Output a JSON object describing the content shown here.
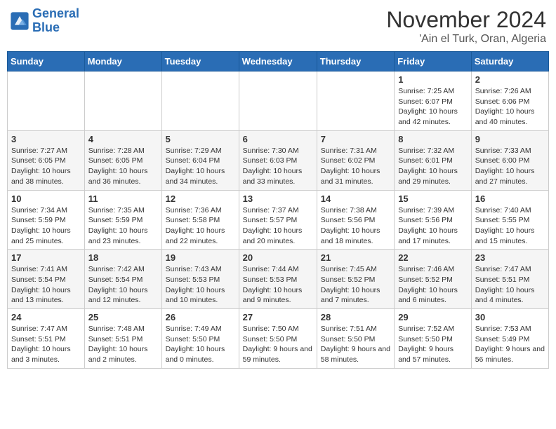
{
  "header": {
    "logo_line1": "General",
    "logo_line2": "Blue",
    "title": "November 2024",
    "subtitle": "'Ain el Turk, Oran, Algeria"
  },
  "weekdays": [
    "Sunday",
    "Monday",
    "Tuesday",
    "Wednesday",
    "Thursday",
    "Friday",
    "Saturday"
  ],
  "weeks": [
    [
      {
        "day": "",
        "info": ""
      },
      {
        "day": "",
        "info": ""
      },
      {
        "day": "",
        "info": ""
      },
      {
        "day": "",
        "info": ""
      },
      {
        "day": "",
        "info": ""
      },
      {
        "day": "1",
        "info": "Sunrise: 7:25 AM\nSunset: 6:07 PM\nDaylight: 10 hours and 42 minutes."
      },
      {
        "day": "2",
        "info": "Sunrise: 7:26 AM\nSunset: 6:06 PM\nDaylight: 10 hours and 40 minutes."
      }
    ],
    [
      {
        "day": "3",
        "info": "Sunrise: 7:27 AM\nSunset: 6:05 PM\nDaylight: 10 hours and 38 minutes."
      },
      {
        "day": "4",
        "info": "Sunrise: 7:28 AM\nSunset: 6:05 PM\nDaylight: 10 hours and 36 minutes."
      },
      {
        "day": "5",
        "info": "Sunrise: 7:29 AM\nSunset: 6:04 PM\nDaylight: 10 hours and 34 minutes."
      },
      {
        "day": "6",
        "info": "Sunrise: 7:30 AM\nSunset: 6:03 PM\nDaylight: 10 hours and 33 minutes."
      },
      {
        "day": "7",
        "info": "Sunrise: 7:31 AM\nSunset: 6:02 PM\nDaylight: 10 hours and 31 minutes."
      },
      {
        "day": "8",
        "info": "Sunrise: 7:32 AM\nSunset: 6:01 PM\nDaylight: 10 hours and 29 minutes."
      },
      {
        "day": "9",
        "info": "Sunrise: 7:33 AM\nSunset: 6:00 PM\nDaylight: 10 hours and 27 minutes."
      }
    ],
    [
      {
        "day": "10",
        "info": "Sunrise: 7:34 AM\nSunset: 5:59 PM\nDaylight: 10 hours and 25 minutes."
      },
      {
        "day": "11",
        "info": "Sunrise: 7:35 AM\nSunset: 5:59 PM\nDaylight: 10 hours and 23 minutes."
      },
      {
        "day": "12",
        "info": "Sunrise: 7:36 AM\nSunset: 5:58 PM\nDaylight: 10 hours and 22 minutes."
      },
      {
        "day": "13",
        "info": "Sunrise: 7:37 AM\nSunset: 5:57 PM\nDaylight: 10 hours and 20 minutes."
      },
      {
        "day": "14",
        "info": "Sunrise: 7:38 AM\nSunset: 5:56 PM\nDaylight: 10 hours and 18 minutes."
      },
      {
        "day": "15",
        "info": "Sunrise: 7:39 AM\nSunset: 5:56 PM\nDaylight: 10 hours and 17 minutes."
      },
      {
        "day": "16",
        "info": "Sunrise: 7:40 AM\nSunset: 5:55 PM\nDaylight: 10 hours and 15 minutes."
      }
    ],
    [
      {
        "day": "17",
        "info": "Sunrise: 7:41 AM\nSunset: 5:54 PM\nDaylight: 10 hours and 13 minutes."
      },
      {
        "day": "18",
        "info": "Sunrise: 7:42 AM\nSunset: 5:54 PM\nDaylight: 10 hours and 12 minutes."
      },
      {
        "day": "19",
        "info": "Sunrise: 7:43 AM\nSunset: 5:53 PM\nDaylight: 10 hours and 10 minutes."
      },
      {
        "day": "20",
        "info": "Sunrise: 7:44 AM\nSunset: 5:53 PM\nDaylight: 10 hours and 9 minutes."
      },
      {
        "day": "21",
        "info": "Sunrise: 7:45 AM\nSunset: 5:52 PM\nDaylight: 10 hours and 7 minutes."
      },
      {
        "day": "22",
        "info": "Sunrise: 7:46 AM\nSunset: 5:52 PM\nDaylight: 10 hours and 6 minutes."
      },
      {
        "day": "23",
        "info": "Sunrise: 7:47 AM\nSunset: 5:51 PM\nDaylight: 10 hours and 4 minutes."
      }
    ],
    [
      {
        "day": "24",
        "info": "Sunrise: 7:47 AM\nSunset: 5:51 PM\nDaylight: 10 hours and 3 minutes."
      },
      {
        "day": "25",
        "info": "Sunrise: 7:48 AM\nSunset: 5:51 PM\nDaylight: 10 hours and 2 minutes."
      },
      {
        "day": "26",
        "info": "Sunrise: 7:49 AM\nSunset: 5:50 PM\nDaylight: 10 hours and 0 minutes."
      },
      {
        "day": "27",
        "info": "Sunrise: 7:50 AM\nSunset: 5:50 PM\nDaylight: 9 hours and 59 minutes."
      },
      {
        "day": "28",
        "info": "Sunrise: 7:51 AM\nSunset: 5:50 PM\nDaylight: 9 hours and 58 minutes."
      },
      {
        "day": "29",
        "info": "Sunrise: 7:52 AM\nSunset: 5:50 PM\nDaylight: 9 hours and 57 minutes."
      },
      {
        "day": "30",
        "info": "Sunrise: 7:53 AM\nSunset: 5:49 PM\nDaylight: 9 hours and 56 minutes."
      }
    ]
  ]
}
